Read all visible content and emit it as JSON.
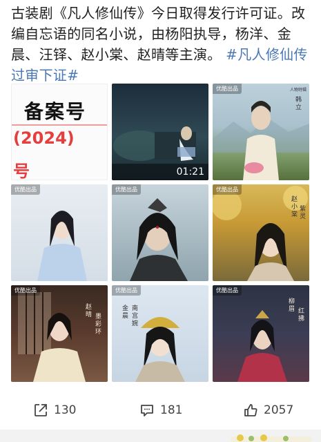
{
  "post": {
    "text": "古装剧《凡人修仙传》今日取得发行许可证。改编自忘语的同名小说，由杨阳执导，杨洋、金晨、汪铎、赵小棠、赵晴等主演。",
    "hashtag": "#凡人修仙传过审下证#"
  },
  "media": {
    "tile1_line1": "备案号",
    "tile1_line2": "(2024)",
    "tile1_line3": "号",
    "video_duration": "01:21",
    "badge": "优酷出品",
    "tile3_credit": "人物特辑",
    "tile3_vertical": "韩立",
    "tile6_vertical": "赵小棠",
    "tile6_vertical_role": "紫灵",
    "tile7_vertical": "赵晴",
    "tile7_vertical_role": "墨彩环",
    "tile8_vertical": "金晨",
    "tile8_vertical_role": "南宫婉",
    "tile9_vertical": "柳眉",
    "tile9_vertical_role": "红拂"
  },
  "actions": {
    "repost_count": "130",
    "comment_count": "181",
    "like_count": "2057"
  },
  "colors": {
    "hashtag": "#4a78b5",
    "highlight": "#e53e3e"
  }
}
